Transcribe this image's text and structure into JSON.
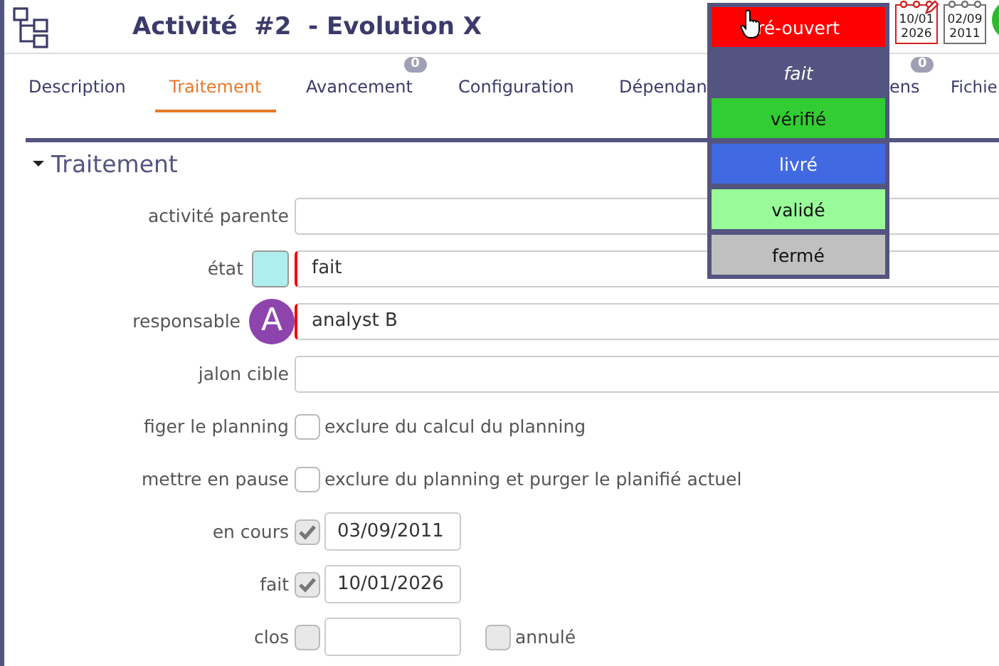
{
  "header": {
    "title": "Activité",
    "number": "#2",
    "name": "- Evolution X"
  },
  "dates": [
    {
      "day": "10/01",
      "year": "2026",
      "color": "#d02020",
      "editable": true
    },
    {
      "day": "02/09",
      "year": "2011",
      "color": "#707070",
      "editable": false
    }
  ],
  "tabs": [
    {
      "label": "Description",
      "selected": false
    },
    {
      "label": "Traitement",
      "selected": true
    },
    {
      "label": "Avancement",
      "selected": false,
      "badge": "0"
    },
    {
      "label": "Configuration",
      "selected": false
    },
    {
      "label": "Dépendan",
      "selected": false
    },
    {
      "label": "ens",
      "selected": false,
      "badge": "0"
    },
    {
      "label": "Fichie",
      "selected": false
    }
  ],
  "section": {
    "title": "Traitement",
    "expanded": true
  },
  "fields": [
    {
      "kind": "text",
      "label": "activité parente"
    },
    {
      "kind": "state",
      "label": "état",
      "color": "#afeeee",
      "value": "fait",
      "required": true
    },
    {
      "kind": "user",
      "label": "responsable",
      "avatar": "A",
      "color": "#8e44ad",
      "value": "analyst B",
      "required": true
    },
    {
      "kind": "text",
      "label": "jalon cible"
    },
    {
      "kind": "checkbox",
      "label": "figer le planning",
      "checked": false,
      "text": "exclure du calcul du planning"
    },
    {
      "kind": "checkbox",
      "label": "mettre en pause",
      "checked": false,
      "text": "exclure du planning et purger le planifié actuel"
    },
    {
      "kind": "date",
      "label": "en cours",
      "checked": true,
      "disabled": true,
      "value": "03/09/2011"
    },
    {
      "kind": "date",
      "label": "fait",
      "checked": true,
      "disabled": true,
      "value": "10/01/2026"
    },
    {
      "kind": "date",
      "label": "clos",
      "checked": false,
      "disabled": true,
      "extra": {
        "label": "annulé",
        "checked": false
      }
    }
  ],
  "menu": [
    {
      "label": "ré-ouvert",
      "color": "#ff0000",
      "current": false,
      "hovered": true
    },
    {
      "label": "fait",
      "color": "#545480",
      "current": true,
      "hovered": false
    },
    {
      "label": "vérifié",
      "color": "#32cd32",
      "current": false,
      "hovered": false
    },
    {
      "label": "livré",
      "color": "#4169e1",
      "current": false,
      "hovered": false
    },
    {
      "label": "validé",
      "color": "#98fb98",
      "current": false,
      "hovered": false
    },
    {
      "label": "fermé",
      "color": "#c0c0c0",
      "current": false,
      "hovered": false
    }
  ]
}
